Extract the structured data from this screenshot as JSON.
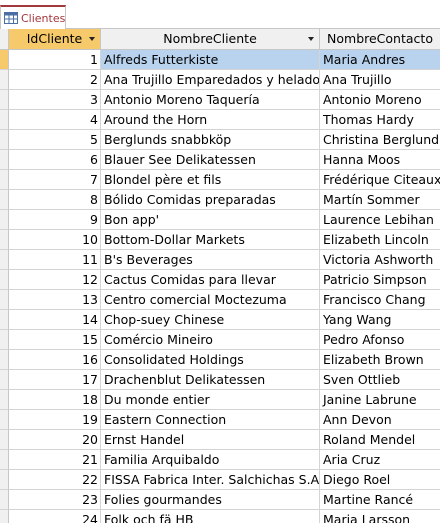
{
  "tab": {
    "label": "Clientes"
  },
  "columns": {
    "id": "IdCliente",
    "name": "NombreCliente",
    "contact": "NombreContacto"
  },
  "rows": [
    {
      "id": "1",
      "name": "Alfreds Futterkiste",
      "contact": "Maria Andres"
    },
    {
      "id": "2",
      "name": "Ana Trujillo Emparedados y helados",
      "contact": "Ana Trujillo"
    },
    {
      "id": "3",
      "name": "Antonio Moreno Taquería",
      "contact": "Antonio Moreno"
    },
    {
      "id": "4",
      "name": "Around the Horn",
      "contact": "Thomas Hardy"
    },
    {
      "id": "5",
      "name": "Berglunds snabbköp",
      "contact": "Christina Berglund"
    },
    {
      "id": "6",
      "name": "Blauer See Delikatessen",
      "contact": "Hanna Moos"
    },
    {
      "id": "7",
      "name": "Blondel père et fils",
      "contact": "Frédérique Citeaux"
    },
    {
      "id": "8",
      "name": "Bólido Comidas preparadas",
      "contact": "Martín Sommer"
    },
    {
      "id": "9",
      "name": "Bon app'",
      "contact": "Laurence Lebihan"
    },
    {
      "id": "10",
      "name": "Bottom-Dollar Markets",
      "contact": "Elizabeth Lincoln"
    },
    {
      "id": "11",
      "name": "B's Beverages",
      "contact": "Victoria Ashworth"
    },
    {
      "id": "12",
      "name": "Cactus Comidas para llevar",
      "contact": "Patricio Simpson"
    },
    {
      "id": "13",
      "name": "Centro comercial Moctezuma",
      "contact": "Francisco Chang"
    },
    {
      "id": "14",
      "name": "Chop-suey Chinese",
      "contact": "Yang Wang"
    },
    {
      "id": "15",
      "name": "Comércio Mineiro",
      "contact": "Pedro Afonso"
    },
    {
      "id": "16",
      "name": "Consolidated Holdings",
      "contact": "Elizabeth Brown"
    },
    {
      "id": "17",
      "name": "Drachenblut Delikatessen",
      "contact": "Sven Ottlieb"
    },
    {
      "id": "18",
      "name": "Du monde entier",
      "contact": "Janine Labrune"
    },
    {
      "id": "19",
      "name": "Eastern Connection",
      "contact": "Ann Devon"
    },
    {
      "id": "20",
      "name": "Ernst Handel",
      "contact": "Roland Mendel"
    },
    {
      "id": "21",
      "name": "Familia Arquibaldo",
      "contact": "Aria Cruz"
    },
    {
      "id": "22",
      "name": "FISSA Fabrica Inter. Salchichas S.A.",
      "contact": "Diego Roel"
    },
    {
      "id": "23",
      "name": "Folies gourmandes",
      "contact": "Martine Rancé"
    },
    {
      "id": "24",
      "name": "Folk och fä HB",
      "contact": "Maria Larsson"
    }
  ],
  "colors": {
    "tab_accent": "#a4373a",
    "selected_header": "#f6c96a",
    "selected_row": "#b9d3ee"
  },
  "icons": {
    "tab": "table-icon",
    "column_menu": "dropdown-arrow-icon"
  }
}
